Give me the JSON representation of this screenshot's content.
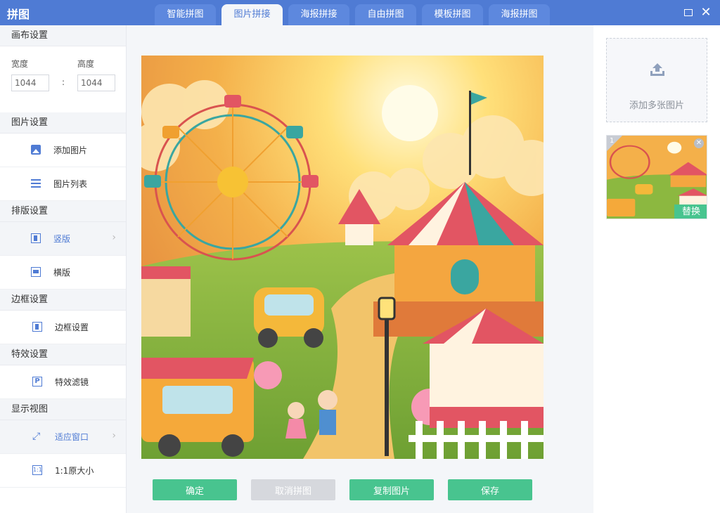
{
  "app": {
    "title": "拼图"
  },
  "tabs": [
    {
      "label": "智能拼图"
    },
    {
      "label": "图片拼接"
    },
    {
      "label": "海报拼接"
    },
    {
      "label": "自由拼图"
    },
    {
      "label": "模板拼图"
    },
    {
      "label": "海报拼图"
    }
  ],
  "active_tab": "图片拼接",
  "window": {
    "close": "✕"
  },
  "sidebar": {
    "canvas": {
      "header": "画布设置",
      "width_label": "宽度",
      "height_label": "高度",
      "width_value": "1044",
      "height_value": "1044",
      "separator": ":"
    },
    "image": {
      "header": "图片设置",
      "items": [
        {
          "label": "添加图片",
          "icon": "image-icon"
        },
        {
          "label": "图片列表",
          "icon": "list-icon"
        }
      ]
    },
    "layout": {
      "header": "排版设置",
      "items": [
        {
          "label": "竖版",
          "icon": "vertical-layout-icon",
          "selected": true
        },
        {
          "label": "横版",
          "icon": "horizontal-layout-icon"
        }
      ]
    },
    "border": {
      "header": "边框设置",
      "items": [
        {
          "label": "边框设置",
          "icon": "border-icon"
        }
      ]
    },
    "effects": {
      "header": "特效设置",
      "items": [
        {
          "label": "特效滤镜",
          "icon": "filter-icon",
          "glyph": "P"
        }
      ]
    },
    "view": {
      "header": "显示视图",
      "items": [
        {
          "label": "适应窗口",
          "icon": "fit-window-icon",
          "glyph": "⤢",
          "selected": true
        },
        {
          "label": "1:1原大小",
          "icon": "actual-size-icon",
          "glyph": "1:1"
        }
      ]
    },
    "arrow": "›"
  },
  "actions": {
    "confirm": "确定",
    "cancel": "取消拼图",
    "copy": "复制图片",
    "save": "保存"
  },
  "right_panel": {
    "add_label": "添加多张图片",
    "thumbnail": {
      "index": "1",
      "close": "✕",
      "replace": "替换"
    }
  },
  "colors": {
    "title_bar": "#4f7bd4",
    "accent": "#4f7bd4",
    "button_green": "#48c48f",
    "button_disabled": "#d6d8dd"
  }
}
